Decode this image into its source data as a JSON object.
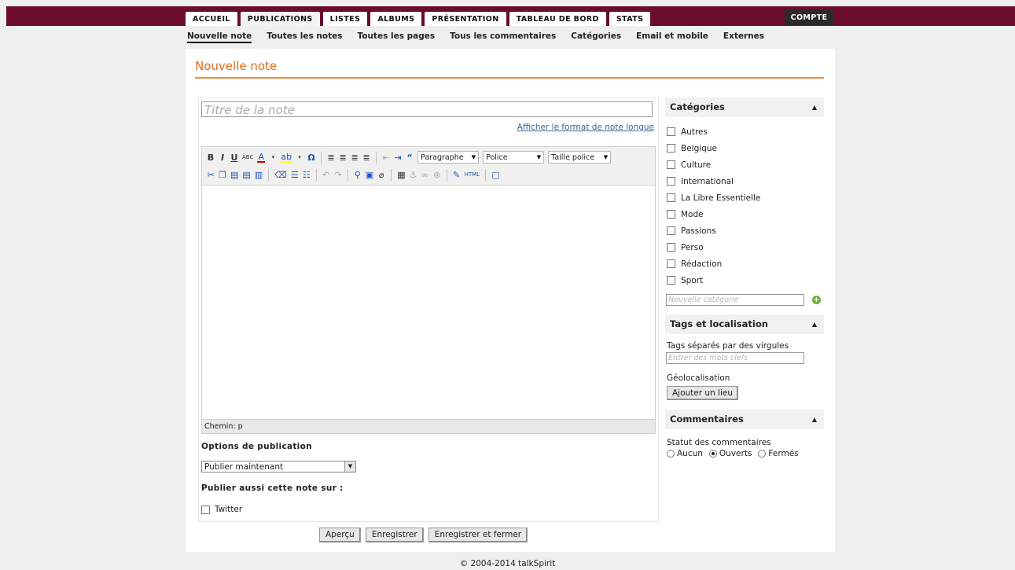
{
  "nav": {
    "tabs": [
      {
        "label": "ACCUEIL"
      },
      {
        "label": "PUBLICATIONS"
      },
      {
        "label": "LISTES"
      },
      {
        "label": "ALBUMS"
      },
      {
        "label": "PRÉSENTATION"
      },
      {
        "label": "TABLEAU DE BORD"
      },
      {
        "label": "STATS"
      }
    ],
    "active_tab": "PUBLICATIONS",
    "account": "COMPTE"
  },
  "subnav": {
    "items": [
      {
        "label": "Nouvelle note"
      },
      {
        "label": "Toutes les notes"
      },
      {
        "label": "Toutes les pages"
      },
      {
        "label": "Tous les commentaires"
      },
      {
        "label": "Catégories"
      },
      {
        "label": "Email et mobile"
      },
      {
        "label": "Externes"
      }
    ],
    "active": "Nouvelle note"
  },
  "page": {
    "title": "Nouvelle note"
  },
  "editor": {
    "title_placeholder": "Titre de la note",
    "long_format_link": "Afficher le format de note longue",
    "format_select": "Paragraphe",
    "font_select": "Police",
    "size_select": "Taille police",
    "path_label": "Chemin: p"
  },
  "publication": {
    "options_title": "Options de publication",
    "option_selected": "Publier maintenant",
    "also_title": "Publier aussi cette note sur :",
    "twitter_label": "Twitter"
  },
  "actions": {
    "preview": "Aperçu",
    "save": "Enregistrer",
    "save_close": "Enregistrer et fermer"
  },
  "sidebar": {
    "categories": {
      "title": "Catégories",
      "items": [
        {
          "label": "Autres"
        },
        {
          "label": "Belgique"
        },
        {
          "label": "Culture"
        },
        {
          "label": "International"
        },
        {
          "label": "La Libre Essentielle"
        },
        {
          "label": "Mode"
        },
        {
          "label": "Passions"
        },
        {
          "label": "Perso"
        },
        {
          "label": "Rédaction"
        },
        {
          "label": "Sport"
        }
      ],
      "new_placeholder": "Nouvelle catégorie"
    },
    "tags": {
      "title": "Tags et localisation",
      "label": "Tags séparés par des virgules",
      "placeholder": "Entrer des mots clefs",
      "geo_label": "Géolocalisation",
      "geo_button": "Ajouter un lieu"
    },
    "comments": {
      "title": "Commentaires",
      "status_label": "Statut des commentaires",
      "options": [
        {
          "label": "Aucun"
        },
        {
          "label": "Ouverts"
        },
        {
          "label": "Fermés"
        }
      ],
      "selected": "Ouverts"
    }
  },
  "footer": {
    "copyright": "© 2004-2014 talkSpirit"
  }
}
